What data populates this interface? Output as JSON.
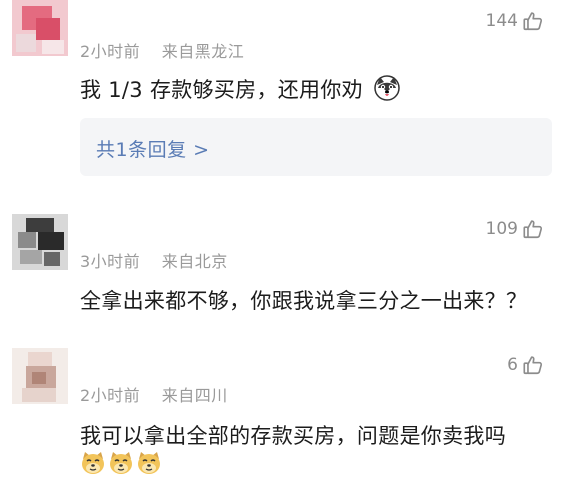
{
  "comments": [
    {
      "time": "2小时前",
      "location": "来自黑龙江",
      "likes": "144",
      "text": "我 1/3 存款够买房，还用你劝",
      "trailing_emoji": "husky-emoji",
      "reply_link": "共1条回复 >"
    },
    {
      "time": "3小时前",
      "location": "来自北京",
      "likes": "109",
      "text": "全拿出来都不够，你跟我说拿三分之一出来？？"
    },
    {
      "time": "2小时前",
      "location": "来自四川",
      "likes": "6",
      "text": "我可以拿出全部的存款买房，问题是你卖我吗",
      "emojis": [
        "doge-emoji",
        "doge-emoji",
        "doge-emoji"
      ]
    }
  ],
  "colors": {
    "meta": "#9a9a9a",
    "text": "#1c1c1c",
    "reply_link": "#5a7cb5",
    "reply_bg": "#f4f5f7"
  }
}
